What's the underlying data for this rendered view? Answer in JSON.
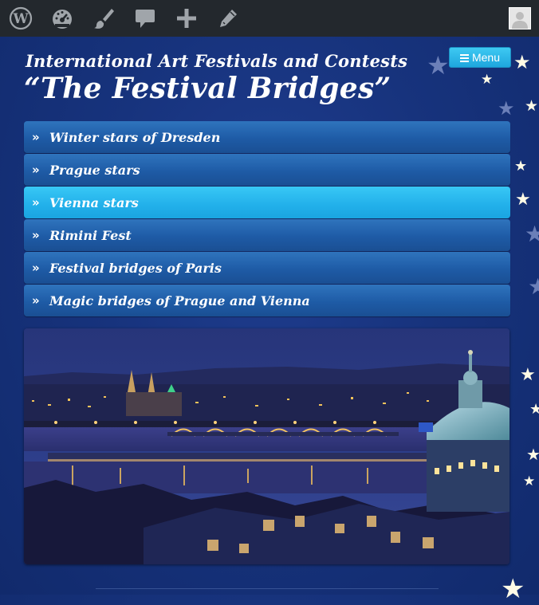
{
  "adminbar": {
    "items": [
      {
        "icon": "wordpress-logo-icon"
      },
      {
        "icon": "dashboard-gauge-icon"
      },
      {
        "icon": "paintbrush-customize-icon"
      },
      {
        "icon": "comment-bubble-icon"
      },
      {
        "icon": "plus-new-icon"
      },
      {
        "icon": "pencil-edit-icon"
      }
    ],
    "avatar": "user-avatar-icon",
    "background": "#23282d"
  },
  "header": {
    "description": "International Art Festivals and Contests",
    "title": "“The Festival Bridges”"
  },
  "menu_button": {
    "label": "Menu",
    "color": "#27b3e6"
  },
  "nav": {
    "items": [
      {
        "label": "Winter stars of Dresden",
        "active": false
      },
      {
        "label": "Prague stars",
        "active": false
      },
      {
        "label": "Vienna stars",
        "active": true
      },
      {
        "label": "Rimini Fest",
        "active": false
      },
      {
        "label": "Festival bridges of Paris",
        "active": false
      },
      {
        "label": "Magic bridges of Prague and Vienna",
        "active": false
      }
    ],
    "chevron": "»",
    "item_color": "#2a69b2",
    "active_color": "#2dbbf0"
  },
  "colors": {
    "background": "#17337d",
    "star": "#fffbe6"
  }
}
